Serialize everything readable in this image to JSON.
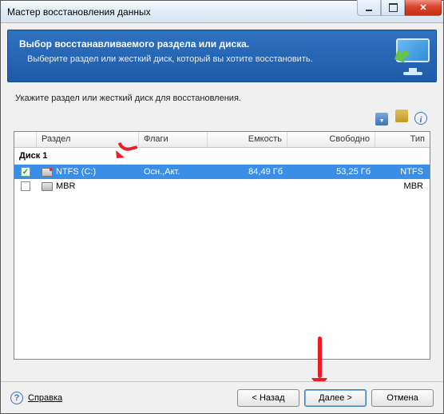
{
  "titlebar": {
    "title": "Мастер восстановления данных"
  },
  "banner": {
    "heading": "Выбор восстанавливаемого раздела или диска.",
    "sub": "Выберите раздел или жесткий диск, который вы хотите восстановить."
  },
  "instruction": "Укажите раздел или жесткий диск для восстановления.",
  "columns": {
    "partition": "Раздел",
    "flags": "Флаги",
    "capacity": "Емкость",
    "free": "Свободно",
    "type": "Тип"
  },
  "group_label": "Диск 1",
  "rows": [
    {
      "checked": true,
      "name": "NTFS (C:)",
      "flags": "Осн.,Акт.",
      "capacity": "84,49 Гб",
      "free": "53,25 Гб",
      "type": "NTFS",
      "selected": true
    },
    {
      "checked": false,
      "name": "MBR",
      "flags": "",
      "capacity": "",
      "free": "",
      "type": "MBR",
      "selected": false
    }
  ],
  "footer": {
    "help": "Справка",
    "back": "< Назад",
    "next": "Далее >",
    "cancel": "Отмена"
  }
}
